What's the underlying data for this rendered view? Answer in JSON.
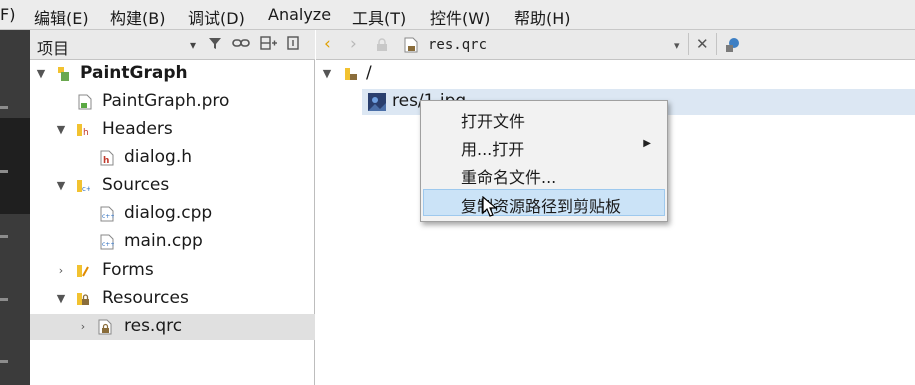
{
  "menubar": {
    "items": [
      "F)",
      "编辑(E)",
      "构建(B)",
      "调试(D)",
      "Analyze",
      "工具(T)",
      "控件(W)",
      "帮助(H)"
    ]
  },
  "left_panel": {
    "title": "项目",
    "toolbar_icons": [
      "chevron-down-icon",
      "filter-icon",
      "link-icon",
      "split-icon",
      "close-panel-icon"
    ]
  },
  "project_tree": [
    {
      "label": "PaintGraph",
      "icon": "project-icon",
      "expanded": true,
      "bold": true
    },
    {
      "label": "PaintGraph.pro",
      "icon": "pro-file-icon"
    },
    {
      "label": "Headers",
      "icon": "headers-folder-icon",
      "expanded": true
    },
    {
      "label": "dialog.h",
      "icon": "header-file-icon"
    },
    {
      "label": "Sources",
      "icon": "sources-folder-icon",
      "expanded": true
    },
    {
      "label": "dialog.cpp",
      "icon": "cpp-file-icon"
    },
    {
      "label": "main.cpp",
      "icon": "cpp-file-icon"
    },
    {
      "label": "Forms",
      "icon": "forms-folder-icon",
      "expanded": false
    },
    {
      "label": "Resources",
      "icon": "resources-folder-icon",
      "expanded": true
    },
    {
      "label": "res.qrc",
      "icon": "qrc-file-icon",
      "expanded": false,
      "selected": true
    }
  ],
  "editor": {
    "document_name": "res.qrc"
  },
  "resource_tree": {
    "prefix": "/",
    "file": "res/1.jpg"
  },
  "context_menu": {
    "items": [
      {
        "label": "打开文件"
      },
      {
        "label": "用...打开",
        "submenu": true
      },
      {
        "label": "重命名文件..."
      },
      {
        "label": "复制资源路径到剪贴板",
        "highlighted": true
      }
    ]
  },
  "colors": {
    "menubar_bg": "#ececec",
    "modebar_bg": "#3b3b3b",
    "selection_bg": "#e0e0e0",
    "menu_highlight": "#cbe3f7",
    "back_arrow": "#e0a000"
  }
}
